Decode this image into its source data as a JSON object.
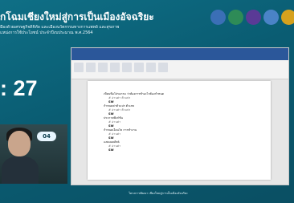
{
  "banner": {
    "title": "กโฉมเชียงใหม่สู่การเป็นเมืองอัจฉริยะ",
    "subtitle_1": "มืองด้วยเศรษฐกิจดิจิทัล และเมืองนวัตกรรมทางการแพทย์ และสุขภาพ",
    "subtitle_2": "แหน่งการใช้ประโยชน์ ประจำปีงบประมาณ พ.ศ.2564"
  },
  "logos": [
    {
      "name": "partner-logo-1",
      "color": "#3b6fb6"
    },
    {
      "name": "partner-logo-2",
      "color": "#2e8b57"
    },
    {
      "name": "partner-logo-3",
      "color": "#5a3a96"
    },
    {
      "name": "partner-logo-4",
      "color": "#4a83c7"
    },
    {
      "name": "partner-logo-5",
      "color": "#d6a11d"
    }
  ],
  "counter": ": 27",
  "document": {
    "lines": [
      {
        "text": "เขียนชื่อโปรแกรม ว่าต้องการทำอะไรต้องกำหนด",
        "style": "main"
      },
      {
        "text": "# อ่านค่า ตัวแปร",
        "style": "sub"
      },
      {
        "text": "SW",
        "style": "bold"
      },
      {
        "text": "กำหนดค่าตัวแปร ตัวเลข",
        "style": "main"
      },
      {
        "text": "# อ่านค่า ตัวแปร",
        "style": "sub"
      },
      {
        "text": "SW",
        "style": "bold"
      },
      {
        "text": "ประกาศฟังก์ชัน",
        "style": "main"
      },
      {
        "text": "# อ่านค่า",
        "style": "sub"
      },
      {
        "text": "SW",
        "style": "bold"
      },
      {
        "text": "กำหนดเงื่อนไข การทำงาน",
        "style": "main"
      },
      {
        "text": "# อ่านค่า",
        "style": "sub"
      },
      {
        "text": "SW",
        "style": "bold"
      },
      {
        "text": "แสดงผลลัพธ์",
        "style": "main"
      },
      {
        "text": "# อ่านค่า",
        "style": "sub"
      },
      {
        "text": "SW",
        "style": "bold"
      }
    ]
  },
  "webcam": {
    "badge": "04"
  },
  "footer": "โครงการพัฒนา เชียงใหม่สู่การเป็นเมืองอัจฉริยะ"
}
